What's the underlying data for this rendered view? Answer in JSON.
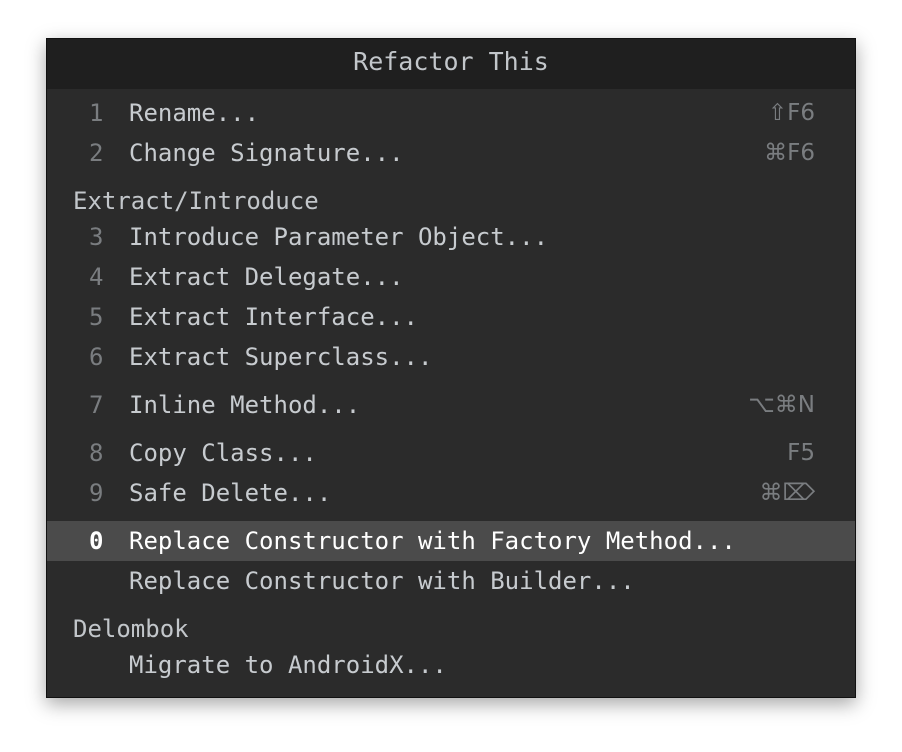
{
  "popup": {
    "title": "Refactor This",
    "items": [
      {
        "num": "1",
        "label": "Rename...",
        "shortcut": "⇧F6"
      },
      {
        "num": "2",
        "label": "Change Signature...",
        "shortcut": "⌘F6"
      },
      {
        "num": "3",
        "label": "Introduce Parameter Object...",
        "shortcut": ""
      },
      {
        "num": "4",
        "label": "Extract Delegate...",
        "shortcut": ""
      },
      {
        "num": "5",
        "label": "Extract Interface...",
        "shortcut": ""
      },
      {
        "num": "6",
        "label": "Extract Superclass...",
        "shortcut": ""
      },
      {
        "num": "7",
        "label": "Inline Method...",
        "shortcut": "⌥⌘N"
      },
      {
        "num": "8",
        "label": "Copy Class...",
        "shortcut": "F5"
      },
      {
        "num": "9",
        "label": "Safe Delete...",
        "shortcut": "⌘⌦"
      },
      {
        "num": "0",
        "label": "Replace Constructor with Factory Method...",
        "shortcut": ""
      },
      {
        "num": "",
        "label": "Replace Constructor with Builder...",
        "shortcut": ""
      },
      {
        "num": "",
        "label": "Migrate to AndroidX...",
        "shortcut": ""
      }
    ],
    "groups": {
      "extract": "Extract/Introduce",
      "delombok": "Delombok"
    },
    "selected_index": 9
  }
}
